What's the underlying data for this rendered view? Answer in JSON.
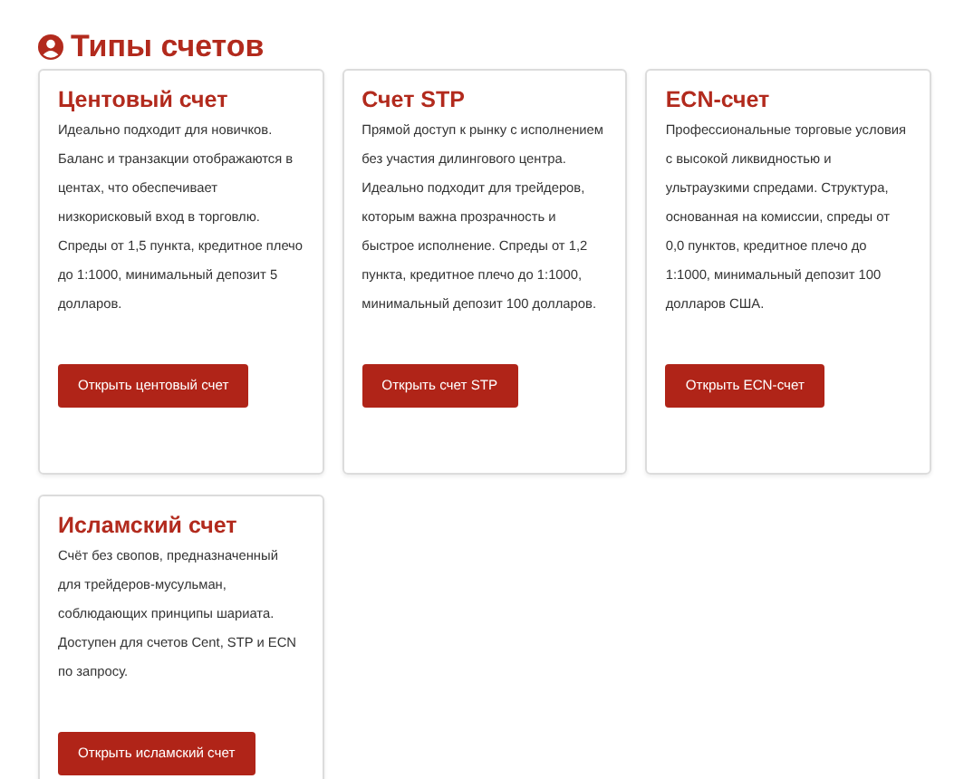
{
  "heading": "Типы счетов",
  "cards": [
    {
      "title": "Центовый счет",
      "text": "Идеально подходит для новичков. Баланс и транзакции отображаются в центах, что обеспечивает низкорисковый вход в торговлю. Спреды от 1,5 пункта, кредитное плечо до 1:1000, минимальный депозит 5 долларов.",
      "button": "Открыть центовый счет"
    },
    {
      "title": "Счет STP",
      "text": "Прямой доступ к рынку с исполнением без участия дилингового центра. Идеально подходит для трейдеров, которым важна прозрачность и быстрое исполнение. Спреды от 1,2 пункта, кредитное плечо до 1:1000, минимальный депозит 100 долларов.",
      "button": "Открыть счет STP"
    },
    {
      "title": "ECN-счет",
      "text": "Профессиональные торговые условия с высокой ликвидностью и ультраузкими спредами. Структура, основанная на комиссии, спреды от 0,0 пунктов, кредитное плечо до 1:1000, минимальный депозит 100 долларов США.",
      "button": "Открыть ECN-счет"
    },
    {
      "title": "Исламский счет",
      "text": "Счёт без свопов, предназначенный для трейдеров-мусульман, соблюдающих принципы шариата. Доступен для счетов Cent, STP и ECN по запросу.",
      "button": "Открыть исламский счет"
    }
  ]
}
